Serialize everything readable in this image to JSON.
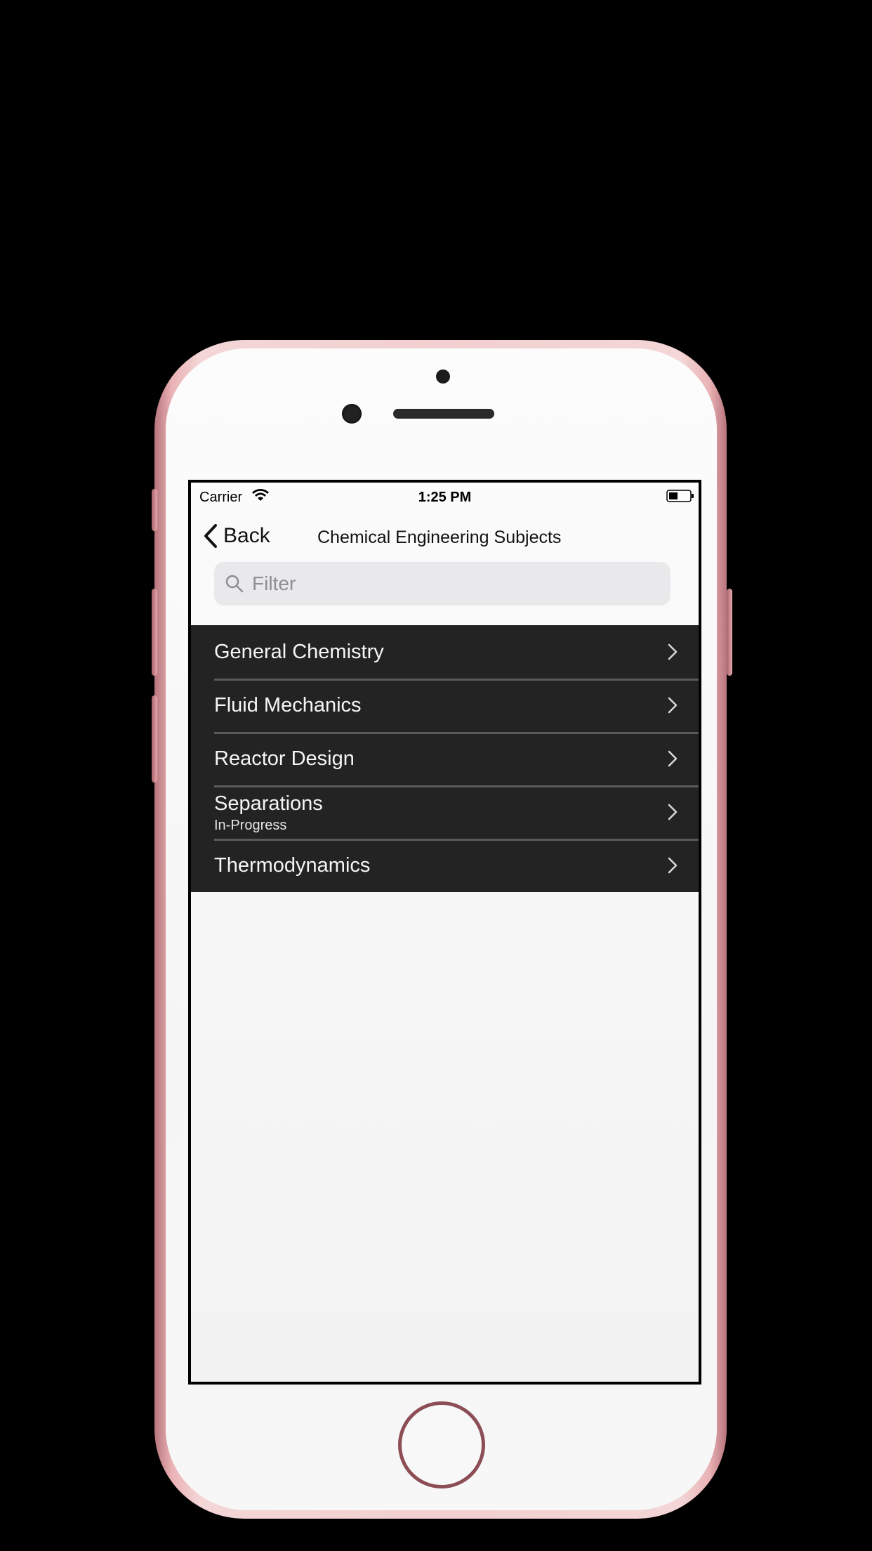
{
  "status_bar": {
    "carrier": "Carrier",
    "time": "1:25 PM"
  },
  "nav": {
    "back_label": "Back",
    "title": "Chemical Engineering Subjects"
  },
  "search": {
    "placeholder": "Filter",
    "value": ""
  },
  "subjects": [
    {
      "title": "General Chemistry",
      "subtitle": ""
    },
    {
      "title": "Fluid Mechanics",
      "subtitle": ""
    },
    {
      "title": "Reactor Design",
      "subtitle": ""
    },
    {
      "title": "Separations",
      "subtitle": "In-Progress"
    },
    {
      "title": "Thermodynamics",
      "subtitle": ""
    }
  ],
  "colors": {
    "list_background": "#232323",
    "separator": "#5a5a5a",
    "phone_body": "#f2cfd0",
    "screen_background": "#f5f5f5"
  },
  "icons": {
    "back": "chevron-left-icon",
    "search": "magnifier-icon",
    "row_disclosure": "chevron-right-icon",
    "wifi": "wifi-icon",
    "battery": "battery-icon"
  }
}
